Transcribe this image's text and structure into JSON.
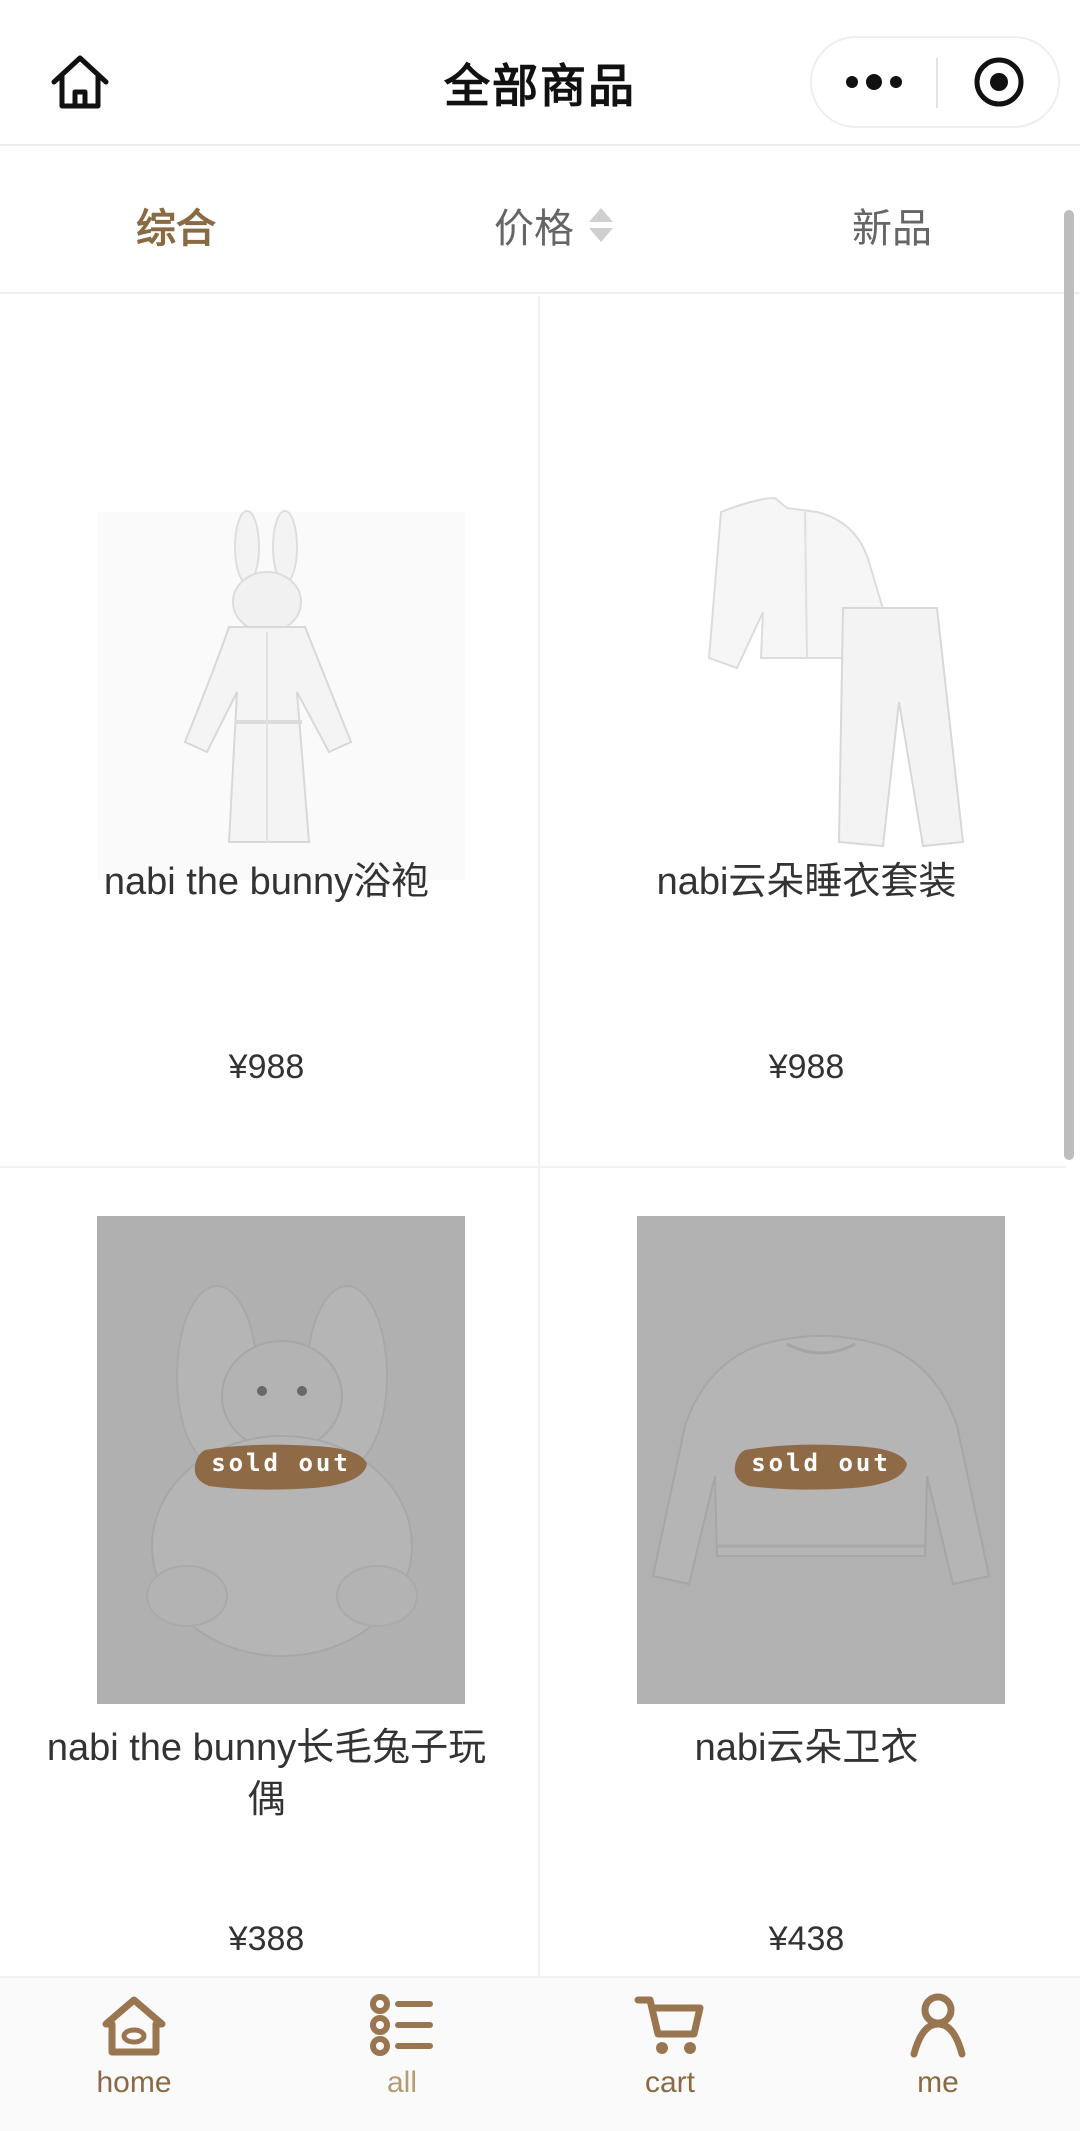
{
  "navbar": {
    "title": "全部商品",
    "home_icon": "home-outline-icon",
    "more_icon": "more-dots-icon",
    "close_icon": "target-circle-icon"
  },
  "sort": {
    "tabs": [
      {
        "label": "综合",
        "active": true
      },
      {
        "label": "价格",
        "active": false,
        "icon": "sort-arrows-icon"
      },
      {
        "label": "新品",
        "active": false
      }
    ],
    "accent": "#8a6a43"
  },
  "products": [
    {
      "title": "nabi the bunny浴袍",
      "price": "¥988",
      "sold_out": false,
      "image": "bunny-robe-image"
    },
    {
      "title": "nabi云朵睡衣套装",
      "price": "¥988",
      "sold_out": false,
      "image": "pajama-set-image"
    },
    {
      "title": "nabi the bunny长毛兔子玩偶",
      "price": "¥388",
      "sold_out": true,
      "sold_out_label": "sold out",
      "image": "plush-bunny-image"
    },
    {
      "title": "nabi云朵卫衣",
      "price": "¥438",
      "sold_out": true,
      "sold_out_label": "sold out",
      "image": "sweatshirt-image"
    }
  ],
  "tabbar": {
    "items": [
      {
        "label": "home",
        "icon": "home-icon"
      },
      {
        "label": "all",
        "icon": "list-icon"
      },
      {
        "label": "cart",
        "icon": "cart-icon"
      },
      {
        "label": "me",
        "icon": "person-icon"
      }
    ],
    "color": "#8a6a43"
  }
}
